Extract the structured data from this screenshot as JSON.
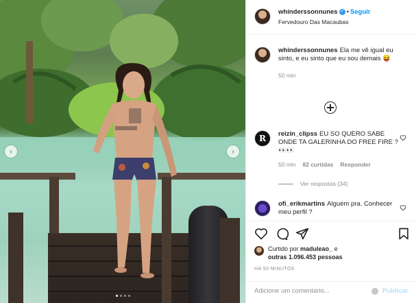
{
  "post": {
    "author": "whinderssonnunes",
    "follow_label": "Seguir",
    "separator": "•",
    "location": "Fervedouro Das Macaubas"
  },
  "caption": {
    "user": "whinderssonnunes",
    "text": "Ela me vê igual eu sinto, e eu sinto que eu sou demais 😝",
    "time": "50 min"
  },
  "comments": [
    {
      "user": "reizin_clipss",
      "text": "EU SO QUERO SABE ONDE TA GALERINHA DO FREE FIRE ? 👀👀",
      "time": "50 min",
      "likes": "82 curtidas",
      "reply_label": "Responder",
      "avatar_letter": "R",
      "view_replies": "Ver respostas (34)"
    },
    {
      "user": "ofi_erikmartins",
      "text": "Alguém pra. Conhecer meu perfil ?"
    }
  ],
  "likes": {
    "prefix": "Curtido por",
    "user": "maduleao_",
    "mid": "e",
    "others": "outras 1.096.453 pessoas"
  },
  "posted_ago": "HÁ 50 MINUTOS",
  "add_comment": {
    "placeholder": "Adicione um comentário...",
    "publish_label": "Publicar"
  },
  "carousel": {
    "prev": "‹",
    "next": "›",
    "current_index": 1,
    "slides": 4
  }
}
